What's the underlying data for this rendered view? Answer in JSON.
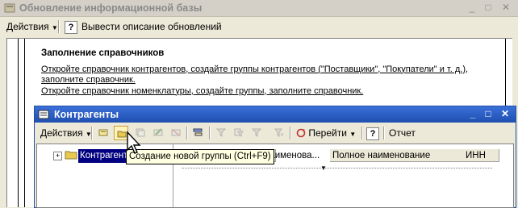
{
  "outer_window": {
    "title": "Обновление информационной базы",
    "toolbar": {
      "actions_label": "Действия",
      "help_symbol": "?",
      "describe_label": "Вывести описание обновлений"
    }
  },
  "document": {
    "heading": "Заполнение справочников",
    "line1": "Откройте справочник контрагентов, создайте группы контрагентов (\"Поставщики\", \"Покупатели\" и т. д.),",
    "line2": "заполните справочник.",
    "line3": "Откройте справочник номенклатуры, создайте группы, заполните справочник."
  },
  "inner_window": {
    "title": "Контрагенты",
    "toolbar": {
      "actions_label": "Действия",
      "goto_label": "Перейти",
      "help_symbol": "?",
      "report_label": "Отчет"
    },
    "tree": {
      "root_label": "Контрагенты"
    },
    "columns": [
      "Наименова...",
      "Полное наименование",
      "ИНН"
    ]
  },
  "tooltip": "Создание новой группы (Ctrl+F9)",
  "window_controls": {
    "minimize": "_",
    "maximize": "□",
    "close": "✕"
  },
  "colors": {
    "title_active": "#2a5fc8",
    "selection": "#000080",
    "tooltip_bg": "#ffffe1"
  }
}
